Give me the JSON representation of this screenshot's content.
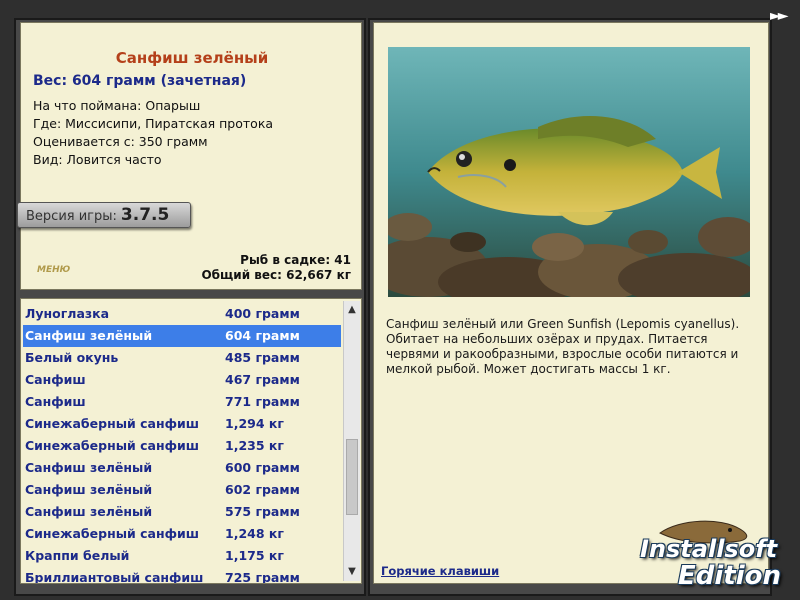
{
  "header": {
    "fast_forward_label": "►►"
  },
  "catch": {
    "title": "Санфиш зелёный",
    "weight_line": "Вес: 604 грамм (зачетная)",
    "details": [
      "На что поймана: Опарыш",
      "Где: Миссисипи, Пиратская протока",
      "Оценивается с: 350 грамм",
      "Вид: Ловится часто"
    ]
  },
  "version": {
    "label": "Версия игры:",
    "number": "3.7.5"
  },
  "menu_logo": "МЕНЮ",
  "stats": {
    "fish_in_net": "Рыб в садке: 41",
    "total_weight": "Общий вес: 62,667 кг"
  },
  "fish_list": [
    {
      "name": "Луноглазка",
      "weight": "400 грамм",
      "selected": false
    },
    {
      "name": "Санфиш зелёный",
      "weight": "604 грамм",
      "selected": true
    },
    {
      "name": "Белый окунь",
      "weight": "485 грамм",
      "selected": false
    },
    {
      "name": "Санфиш",
      "weight": "467 грамм",
      "selected": false
    },
    {
      "name": "Санфиш",
      "weight": "771 грамм",
      "selected": false
    },
    {
      "name": "Синежаберный санфиш",
      "weight": "1,294 кг",
      "selected": false
    },
    {
      "name": "Синежаберный санфиш",
      "weight": "1,235 кг",
      "selected": false
    },
    {
      "name": "Санфиш зелёный",
      "weight": "600 грамм",
      "selected": false
    },
    {
      "name": "Санфиш зелёный",
      "weight": "602 грамм",
      "selected": false
    },
    {
      "name": "Санфиш зелёный",
      "weight": "575 грамм",
      "selected": false
    },
    {
      "name": "Синежаберный санфиш",
      "weight": "1,248 кг",
      "selected": false
    },
    {
      "name": "Краппи белый",
      "weight": "1,175 кг",
      "selected": false
    },
    {
      "name": "Бриллиантовый санфиш",
      "weight": "725 грамм",
      "selected": false
    }
  ],
  "description": "Санфиш зелёный или Green Sunfish (Lepomis cyanellus). Обитает на небольших озёрах и прудах. Питается червями и ракообразными, взрослые особи питаются и мелкой рыбой. Может достигать массы 1 кг.",
  "hotkeys_link": "Горячие клавиши",
  "watermark": {
    "line1": "Installsoft",
    "line2": "Edition"
  },
  "colors": {
    "accent_title": "#b4401a",
    "accent_text": "#1c2a8a",
    "selection": "#3d7ee8",
    "panel_bg": "#f4f1d4"
  }
}
